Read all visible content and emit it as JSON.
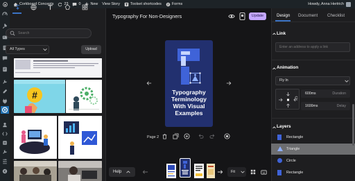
{
  "admin_bar": {
    "site_name": "Corkboard Concepts",
    "updates_count": "23",
    "comments_count": "0",
    "new_label": "New",
    "view_story_label": "View Story",
    "toolset_label": "Toolset shortcodes",
    "forms_label": "Forms",
    "greeting": "Howdy, Anna Hertrich"
  },
  "library": {
    "search_placeholder": "Search",
    "type_filter": "All Types",
    "upload_label": "Upload"
  },
  "editor": {
    "story_title": "Typography For Non-Designers",
    "update_label": "Update",
    "page_title": "Typography Terminology With Visual Examples",
    "page_label": "Page 2",
    "help_label": "Help",
    "zoom_label": "Fit"
  },
  "design_panel": {
    "tabs": [
      "Design",
      "Document",
      "Checklist"
    ],
    "link_heading": "Link",
    "link_placeholder": "Enter an address to apply a link",
    "animation_heading": "Animation",
    "animation_type": "Fly In",
    "duration_value": "600ms",
    "duration_label": "Duration",
    "delay_value": "1600ms",
    "delay_label": "Delay",
    "layers_heading": "Layers",
    "layers": [
      {
        "label": "Rectangle",
        "selected": false
      },
      {
        "label": "Triangle",
        "selected": true
      },
      {
        "label": "Circle",
        "selected": false
      },
      {
        "label": "Rectangle",
        "selected": false
      }
    ]
  },
  "colors": {
    "update_button": "#c4a7ff",
    "page_background": "#22306f",
    "accent_blue": "#3b73c4",
    "selected_layer": "#6d6e70"
  }
}
